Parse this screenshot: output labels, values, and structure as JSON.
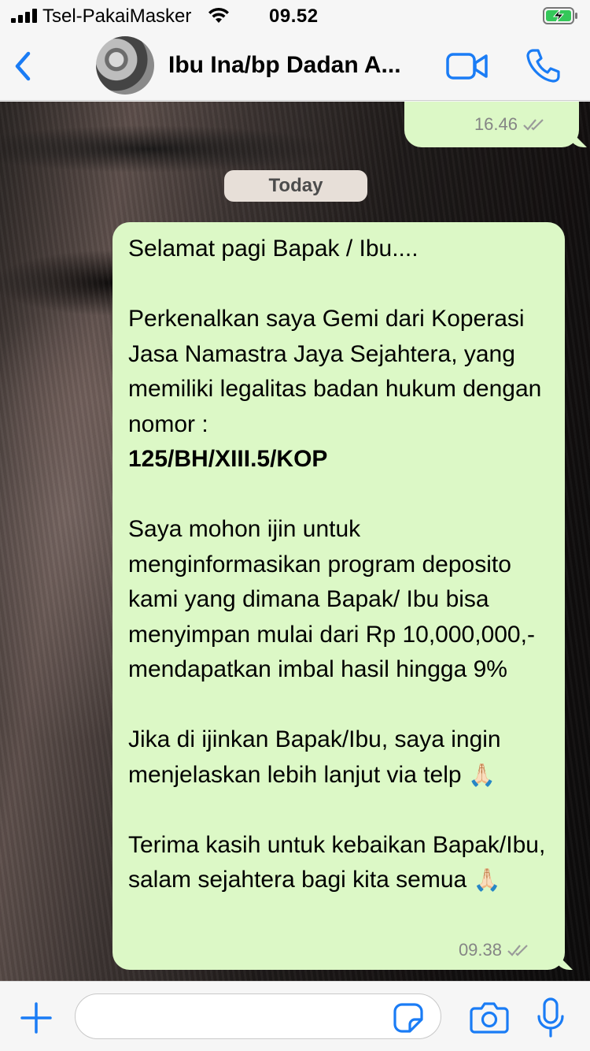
{
  "status_bar": {
    "carrier": "Tsel-PakaiMasker",
    "time": "09.52",
    "signal_bars": 4,
    "battery_state": "charging"
  },
  "header": {
    "contact_name": "Ibu Ina/bp Dadan  A...",
    "back_icon": "chevron-left-icon",
    "video_icon": "video-camera-icon",
    "call_icon": "phone-icon"
  },
  "chat": {
    "previous_message": {
      "time": "16.46",
      "status": "read"
    },
    "day_separator": "Today",
    "message": {
      "paragraphs": [
        {
          "text": "Selamat pagi Bapak / Ibu...."
        },
        {
          "text": "Perkenalkan saya Gemi dari Koperasi Jasa Namastra Jaya Sejahtera, yang memiliki legalitas badan hukum dengan nomor :",
          "bold": "125/BH/XIII.5/KOP"
        },
        {
          "text": "Saya mohon ijin untuk menginformasikan program deposito kami yang dimana Bapak/ Ibu bisa menyimpan mulai dari Rp 10,000,000,- mendapatkan imbal hasil hingga 9%"
        },
        {
          "text": "Jika di ijinkan Bapak/Ibu, saya ingin menjelaskan lebih lanjut via telp",
          "emoji": "🙏🏻"
        },
        {
          "text": "Terima kasih untuk kebaikan Bapak/Ibu, salam sejahtera bagi kita semua",
          "emoji": "🙏🏻"
        }
      ],
      "time": "09.38",
      "status": "read"
    }
  },
  "input_bar": {
    "placeholder": "",
    "value": "",
    "icons": [
      "plus-icon",
      "sticker-icon",
      "camera-icon",
      "microphone-icon"
    ]
  },
  "colors": {
    "accent": "#1a7cf5",
    "bubble_out": "#dcf8c6",
    "day_pill": "#e7dfd8",
    "meta_text": "#858585"
  }
}
